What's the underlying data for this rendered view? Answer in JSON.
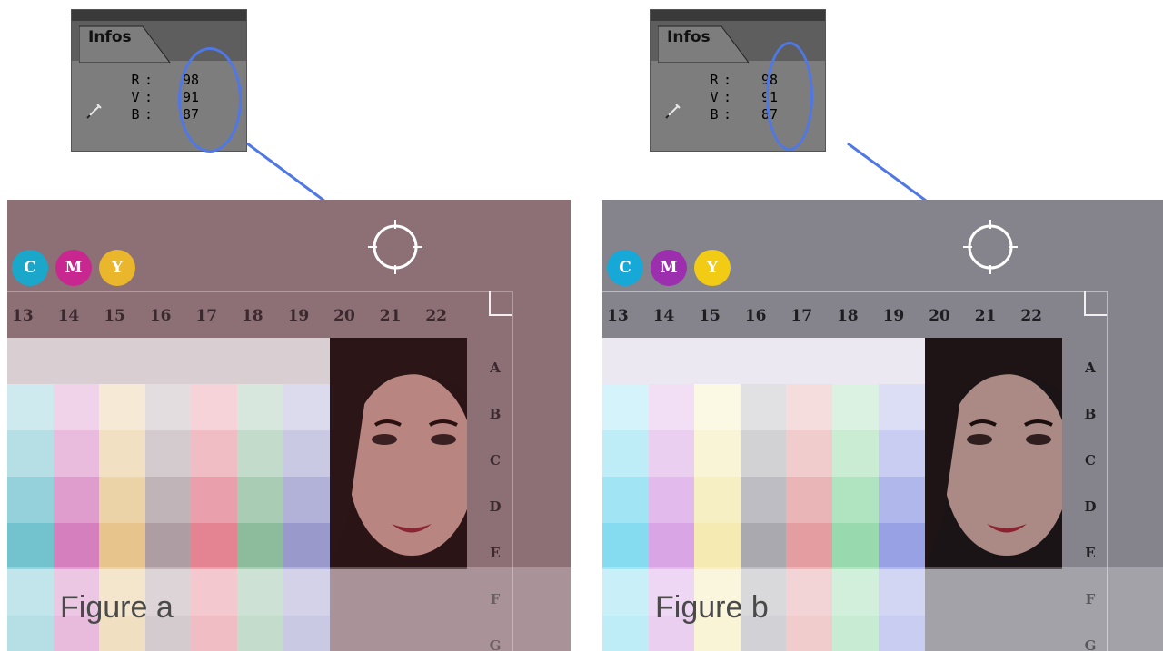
{
  "panels": [
    {
      "id": "a",
      "figure_label": "Figure a",
      "infos": {
        "tab_label": "Infos",
        "rows": [
          {
            "channel": "R",
            "value": "98"
          },
          {
            "channel": "V",
            "value": "91"
          },
          {
            "channel": "B",
            "value": "87"
          }
        ]
      },
      "cmy": [
        "C",
        "M",
        "Y"
      ],
      "columns": [
        "13",
        "14",
        "15",
        "16",
        "17",
        "18",
        "19",
        "20",
        "21",
        "22"
      ],
      "rows": [
        "A",
        "B",
        "C",
        "D",
        "E",
        "F",
        "G"
      ],
      "colors": {
        "background": "#8d6f76",
        "text": "#3a2a2e",
        "frame": "#b59aa0",
        "patch_top_row": "#d9cfd2",
        "swatches": [
          "#5ab8c6",
          "#cd68b4",
          "#e1b978",
          "#a08c93",
          "#df6d7f",
          "#79b08c",
          "#8887c3"
        ]
      }
    },
    {
      "id": "b",
      "figure_label": "Figure b",
      "infos": {
        "tab_label": "Infos",
        "rows": [
          {
            "channel": "R",
            "value": "98"
          },
          {
            "channel": "V",
            "value": "91"
          },
          {
            "channel": "B",
            "value": "87"
          }
        ]
      },
      "cmy": [
        "C",
        "M",
        "Y"
      ],
      "columns": [
        "13",
        "14",
        "15",
        "16",
        "17",
        "18",
        "19",
        "20",
        "21",
        "22"
      ],
      "rows": [
        "A",
        "B",
        "C",
        "D",
        "E",
        "F",
        "G"
      ],
      "colors": {
        "background": "#85838b",
        "text": "#1e1e22",
        "frame": "#bcbac3",
        "patch_top_row": "#ece8f2",
        "swatches": [
          "#6fd6ee",
          "#d295e0",
          "#f3e6a4",
          "#9b9aa2",
          "#df8d90",
          "#86d49e",
          "#8690df"
        ]
      }
    }
  ],
  "accent": "#4f78e6"
}
